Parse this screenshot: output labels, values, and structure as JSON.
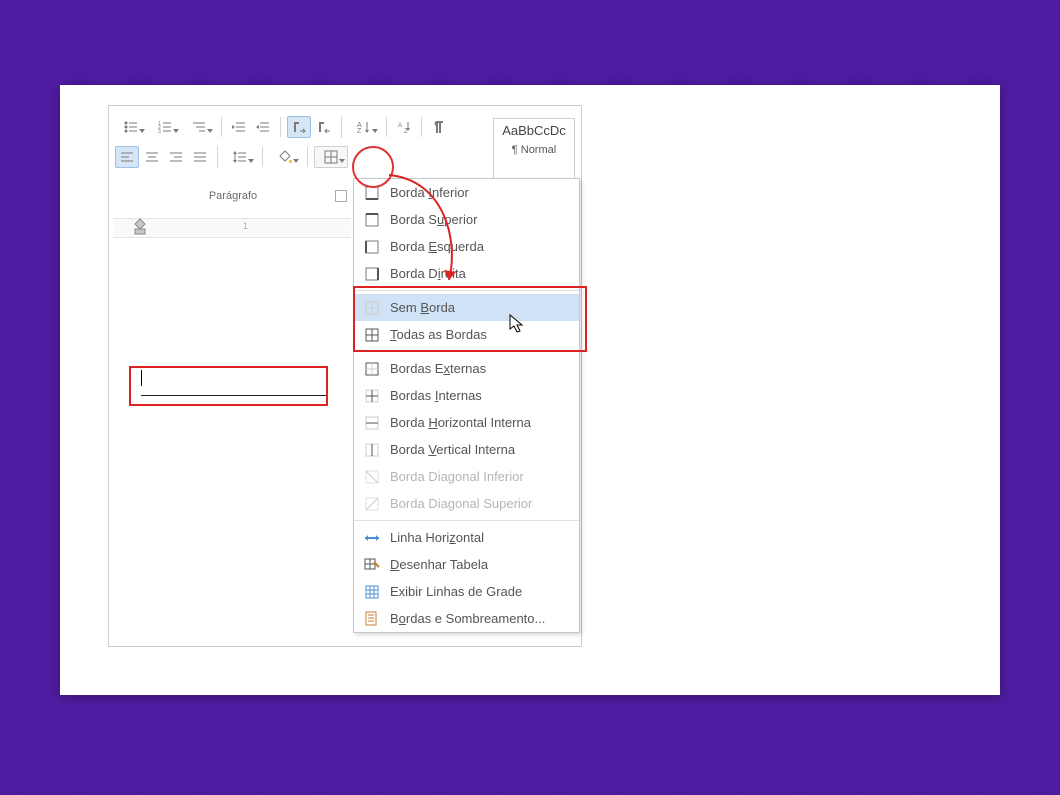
{
  "ribbon": {
    "group_label": "Parágrafo",
    "style_sample": "AaBbCcDc",
    "style_name": "¶ Normal",
    "ruler_ticks": [
      "1"
    ]
  },
  "menu": {
    "items": [
      {
        "key": "inferior",
        "pre": "Borda ",
        "hot": "I",
        "post": "nferior"
      },
      {
        "key": "superior",
        "pre": "Borda S",
        "hot": "u",
        "post": "perior"
      },
      {
        "key": "esquerda",
        "pre": "Borda ",
        "hot": "E",
        "post": "squerda"
      },
      {
        "key": "direita",
        "pre": "Borda D",
        "hot": "i",
        "post": "reita"
      },
      {
        "key": "sem",
        "pre": "Sem ",
        "hot": "B",
        "post": "orda",
        "selected": true
      },
      {
        "key": "todas",
        "pre": "",
        "hot": "T",
        "post": "odas as Bordas"
      },
      {
        "key": "externas",
        "pre": "Bordas E",
        "hot": "x",
        "post": "ternas"
      },
      {
        "key": "internas",
        "pre": "Bordas ",
        "hot": "I",
        "post": "nternas"
      },
      {
        "key": "hint",
        "pre": "Borda ",
        "hot": "H",
        "post": "orizontal Interna"
      },
      {
        "key": "vint",
        "pre": "Borda ",
        "hot": "V",
        "post": "ertical Interna"
      },
      {
        "key": "diaginf",
        "pre": "Borda Diagonal Inferior",
        "hot": "",
        "post": "",
        "disabled": true
      },
      {
        "key": "diagsup",
        "pre": "Borda Diagonal Superior",
        "hot": "",
        "post": "",
        "disabled": true
      },
      {
        "key": "linhah",
        "pre": "Linha Hori",
        "hot": "z",
        "post": "ontal"
      },
      {
        "key": "desenhar",
        "pre": "",
        "hot": "D",
        "post": "esenhar Tabela"
      },
      {
        "key": "grade",
        "pre": "Exibir Linhas de Grade",
        "hot": "",
        "post": ""
      },
      {
        "key": "sombr",
        "pre": "B",
        "hot": "o",
        "post": "rdas e Sombreamento..."
      }
    ]
  },
  "colors": {
    "accent": "#2b579a",
    "highlight": "#dd2222"
  }
}
